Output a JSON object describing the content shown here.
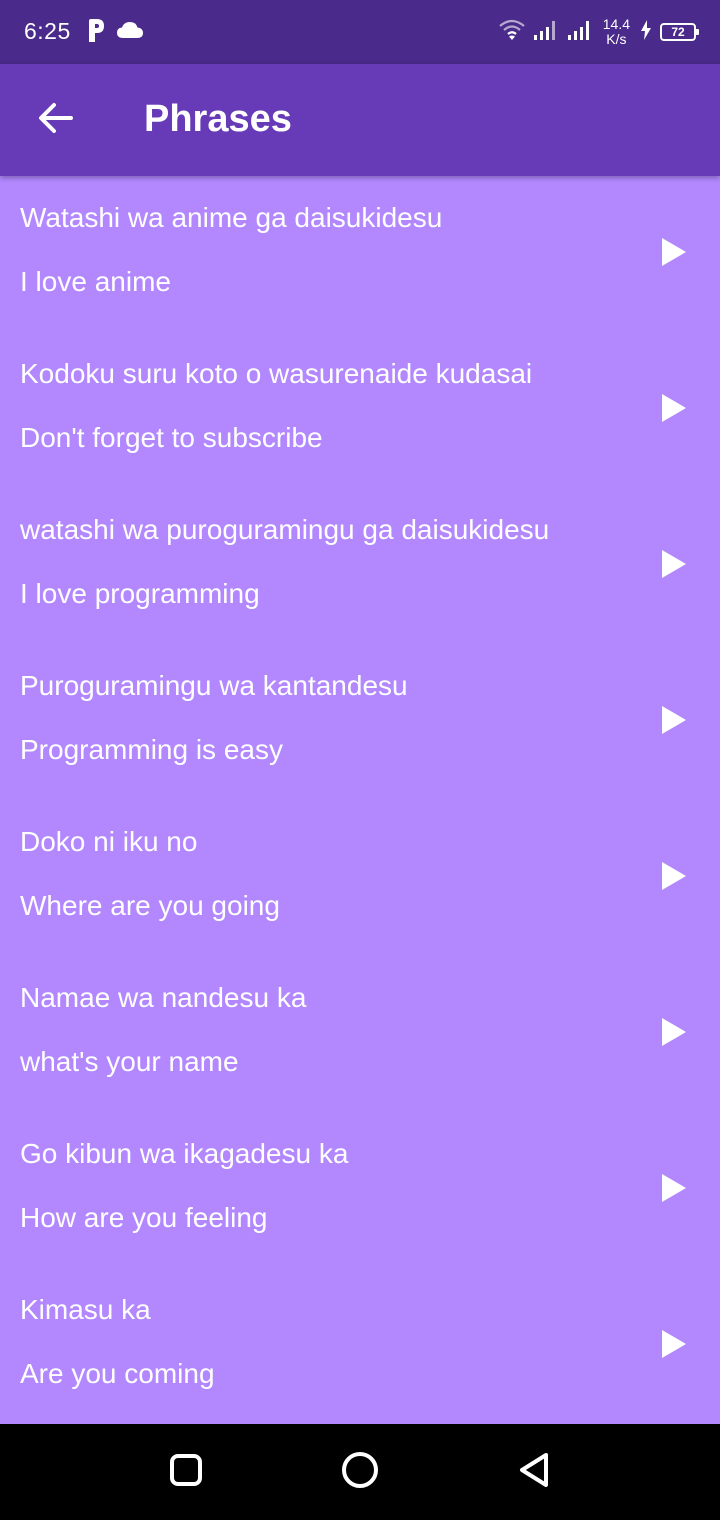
{
  "status_bar": {
    "time": "6:25",
    "left_icons": [
      "parking-app-icon",
      "cloud-icon"
    ],
    "net_speed_value": "14.4",
    "net_speed_unit": "K/s",
    "battery_level": "72"
  },
  "app_bar": {
    "title": "Phrases",
    "back_icon": "arrow-left-icon"
  },
  "colors": {
    "status_bar": "#4a2a8a",
    "app_bar": "#673ab7",
    "list_background": "#b388ff",
    "text": "#ffffff",
    "nav_bar": "#000000"
  },
  "phrases": [
    {
      "japanese": "Watashi wa anime ga daisukidesu",
      "english": "I love anime"
    },
    {
      "japanese": "Kodoku suru koto o wasurenaide kudasai",
      "english": "Don't forget to subscribe"
    },
    {
      "japanese": "watashi wa puroguramingu ga daisukidesu",
      "english": "I love programming"
    },
    {
      "japanese": "Puroguramingu wa kantandesu",
      "english": "Programming is easy"
    },
    {
      "japanese": "Doko ni iku no",
      "english": "Where are you going"
    },
    {
      "japanese": "Namae wa nandesu ka",
      "english": "what's your name"
    },
    {
      "japanese": "Go kibun wa ikagadesu ka",
      "english": "How are you feeling"
    },
    {
      "japanese": "Kimasu ka",
      "english": "Are you coming"
    }
  ],
  "nav_bar": {
    "buttons": [
      "recents-square-icon",
      "home-circle-icon",
      "back-triangle-icon"
    ]
  }
}
